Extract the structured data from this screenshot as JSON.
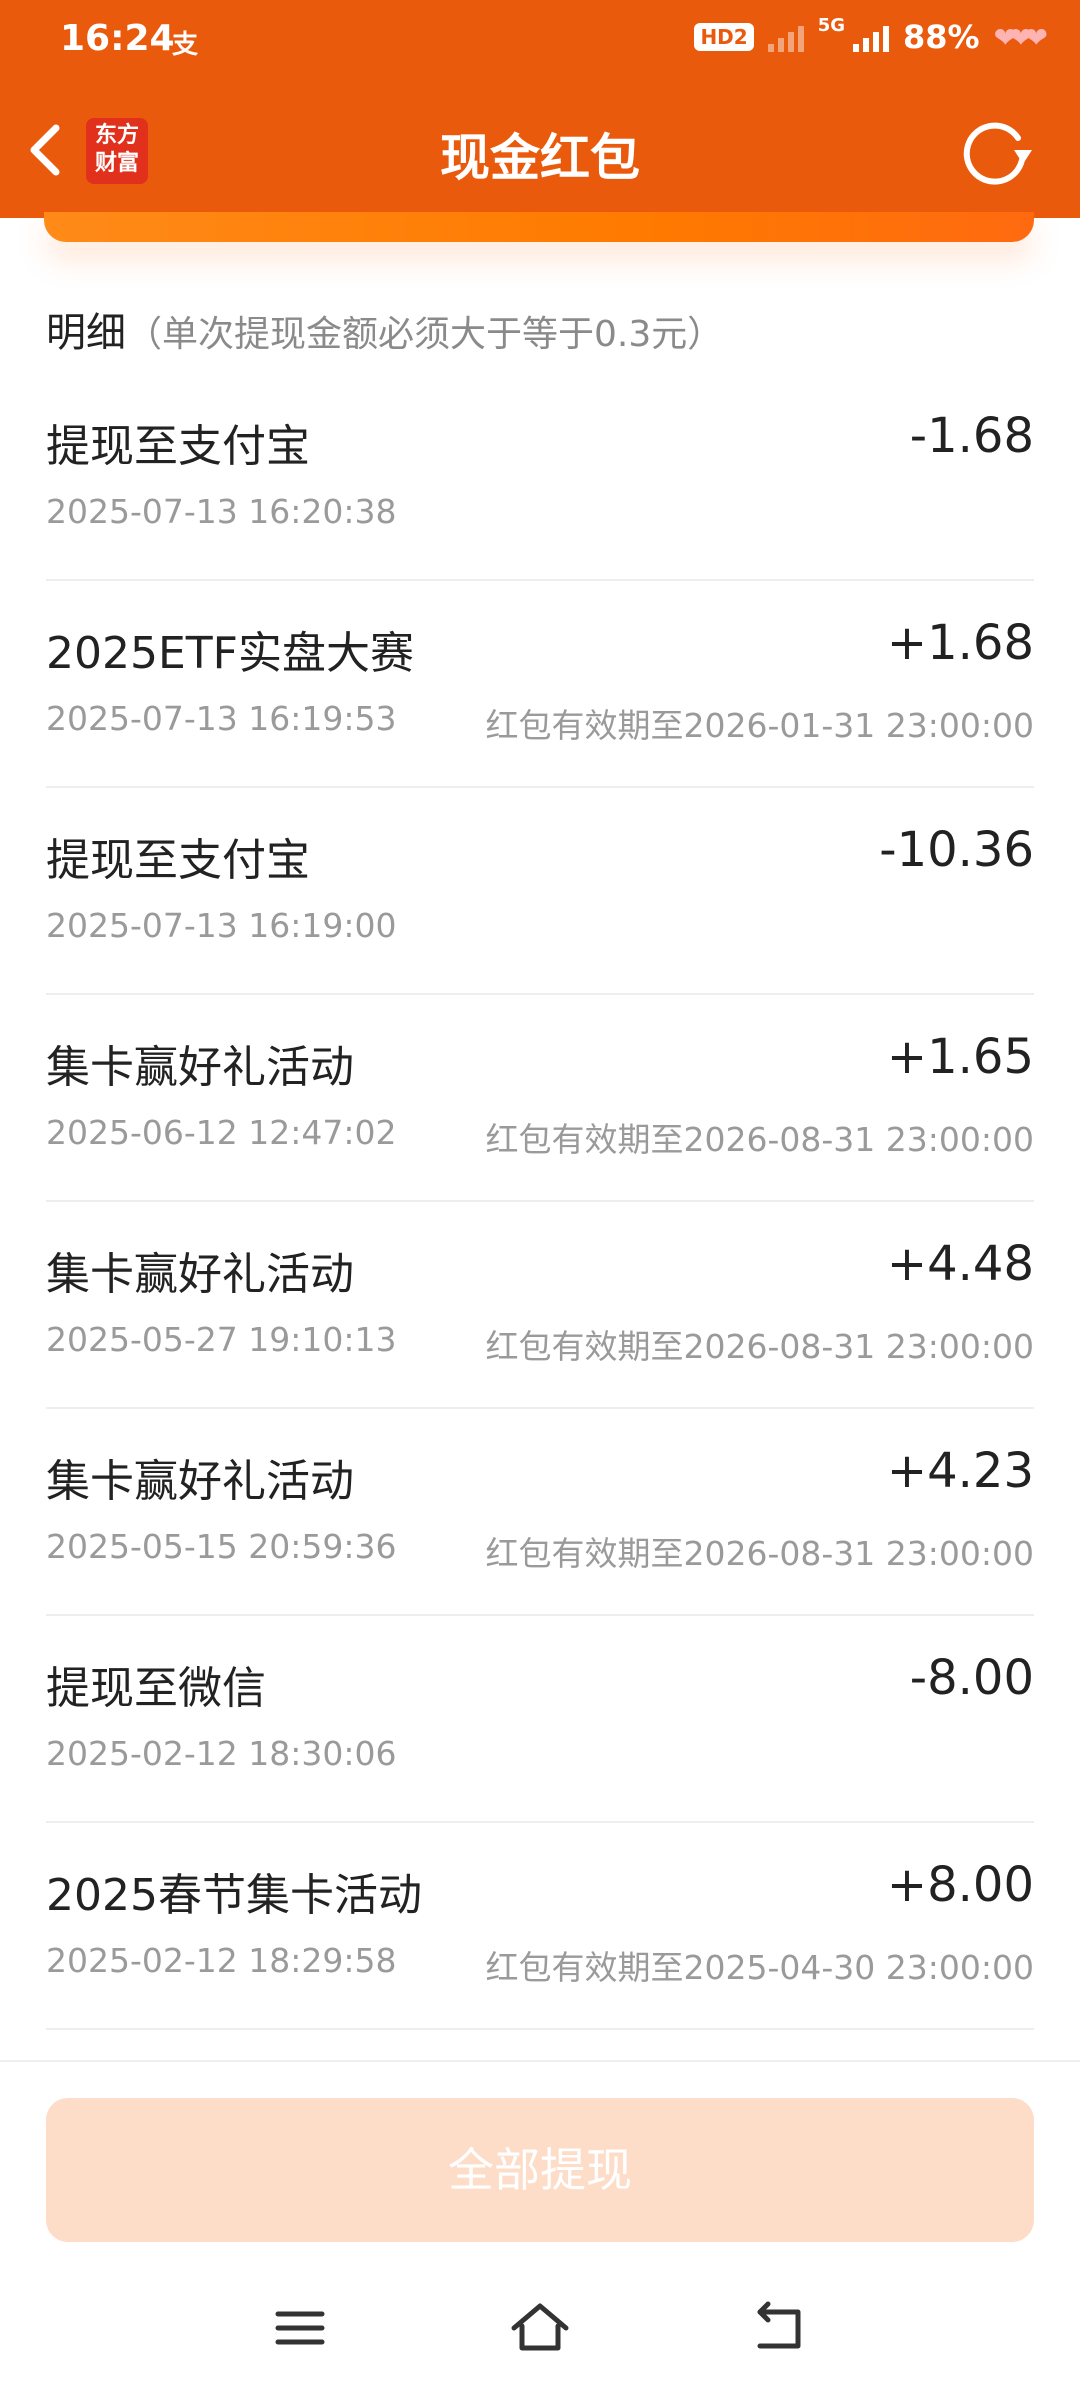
{
  "status_bar": {
    "time": "16:24",
    "alipay_icon": "支",
    "network_badge": "HD2",
    "network_type": "5G",
    "battery": "88%"
  },
  "header": {
    "logo_text_line1": "东方",
    "logo_text_line2": "财富",
    "title": "现金红包"
  },
  "section": {
    "title": "明细",
    "note": "（单次提现金额必须大于等于0.3元）"
  },
  "transactions": [
    {
      "name": "提现至支付宝",
      "date": "2025-07-13 16:20:38",
      "amount": "-1.68",
      "expiry": ""
    },
    {
      "name": "2025ETF实盘大赛",
      "date": "2025-07-13 16:19:53",
      "amount": "+1.68",
      "expiry": "红包有效期至2026-01-31 23:00:00"
    },
    {
      "name": "提现至支付宝",
      "date": "2025-07-13 16:19:00",
      "amount": "-10.36",
      "expiry": ""
    },
    {
      "name": "集卡赢好礼活动",
      "date": "2025-06-12 12:47:02",
      "amount": "+1.65",
      "expiry": "红包有效期至2026-08-31 23:00:00"
    },
    {
      "name": "集卡赢好礼活动",
      "date": "2025-05-27 19:10:13",
      "amount": "+4.48",
      "expiry": "红包有效期至2026-08-31 23:00:00"
    },
    {
      "name": "集卡赢好礼活动",
      "date": "2025-05-15 20:59:36",
      "amount": "+4.23",
      "expiry": "红包有效期至2026-08-31 23:00:00"
    },
    {
      "name": "提现至微信",
      "date": "2025-02-12 18:30:06",
      "amount": "-8.00",
      "expiry": ""
    },
    {
      "name": "2025春节集卡活动",
      "date": "2025-02-12 18:29:58",
      "amount": "+8.00",
      "expiry": "红包有效期至2025-04-30 23:00:00"
    }
  ],
  "bottom": {
    "withdraw_all_label": "全部提现"
  },
  "colors": {
    "brand_orange": "#ea5a0d",
    "button_disabled": "#fddcc8"
  },
  "icons": [
    "back-arrow-icon",
    "refresh-icon",
    "menu-icon",
    "home-icon",
    "return-icon"
  ]
}
